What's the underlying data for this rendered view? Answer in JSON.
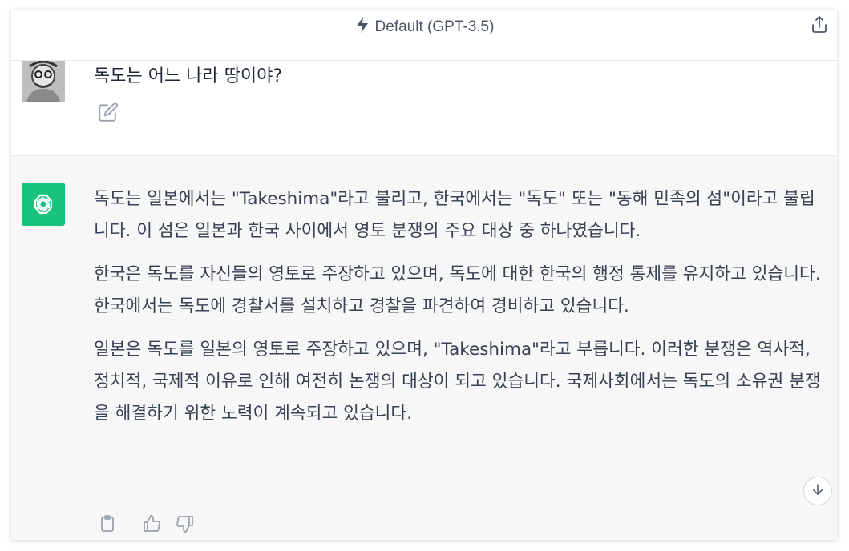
{
  "header": {
    "model_title": "Default (GPT-3.5)",
    "bolt_icon": "lightning-bolt-icon",
    "share_icon": "share-icon"
  },
  "user_message": {
    "text": "독도는 어느 나라 땅이야?",
    "edit_icon": "edit-icon"
  },
  "assistant_message": {
    "paragraphs": [
      "독도는 일본에서는 \"Takeshima\"라고 불리고, 한국에서는 \"독도\" 또는 \"동해 민족의 섬\"이라고 불립니다. 이 섬은 일본과 한국 사이에서 영토 분쟁의 주요 대상 중 하나였습니다.",
      "한국은 독도를 자신들의 영토로 주장하고 있으며, 독도에 대한 한국의 행정 통제를 유지하고 있습니다. 한국에서는 독도에 경찰서를 설치하고 경찰을 파견하여 경비하고 있습니다.",
      "일본은 독도를 일본의 영토로 주장하고 있으며, \"Takeshima\"라고 부릅니다. 이러한 분쟁은 역사적, 정치적, 국제적 이유로 인해 여전히 논쟁의 대상이 되고 있습니다. 국제사회에서는 독도의 소유권 분쟁을 해결하기 위한 노력이 계속되고 있습니다."
    ],
    "actions": [
      "copy-icon",
      "thumbs-up-icon",
      "thumbs-down-icon"
    ]
  },
  "colors": {
    "accent": "#19c37d",
    "assistant_bg": "#f7f7f8",
    "text": "#374151"
  }
}
